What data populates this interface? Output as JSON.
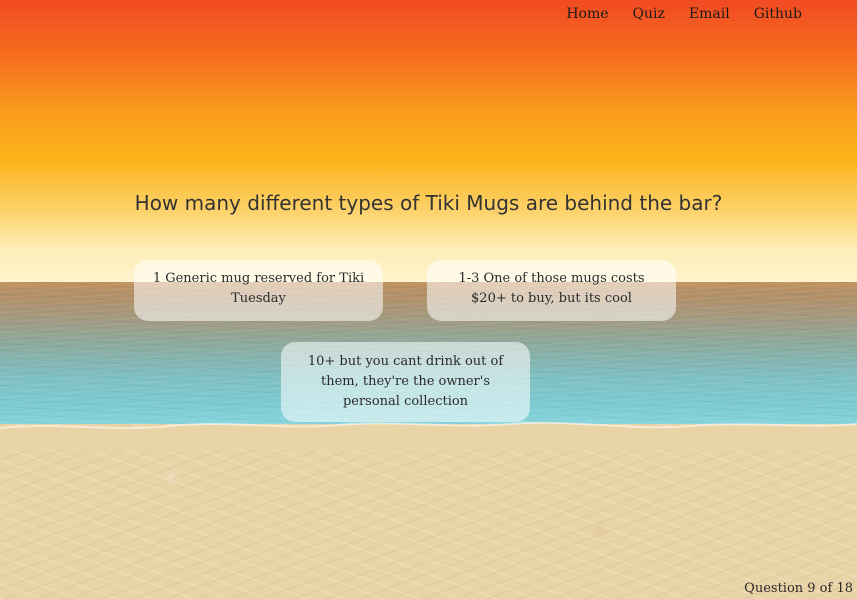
{
  "nav": {
    "items": [
      {
        "label": "Home"
      },
      {
        "label": "Quiz"
      },
      {
        "label": "Email"
      },
      {
        "label": "Github"
      }
    ]
  },
  "quiz": {
    "question": "How many different types of Tiki Mugs are behind the bar?",
    "answers": [
      {
        "label": "1 Generic mug reserved for Tiki Tuesday"
      },
      {
        "label": "1-3 One of those mugs costs $20+ to buy, but its cool"
      },
      {
        "label": "10+ but you cant drink out of them, they're the owner's personal collection"
      }
    ],
    "progress": "Question 9 of 18"
  },
  "colors": {
    "sky_top": "#f24a22",
    "sky_mid": "#fbb41a",
    "horizon": "#fff4cf",
    "sea": "#7ecfd6",
    "sand": "#e9d4a8"
  }
}
